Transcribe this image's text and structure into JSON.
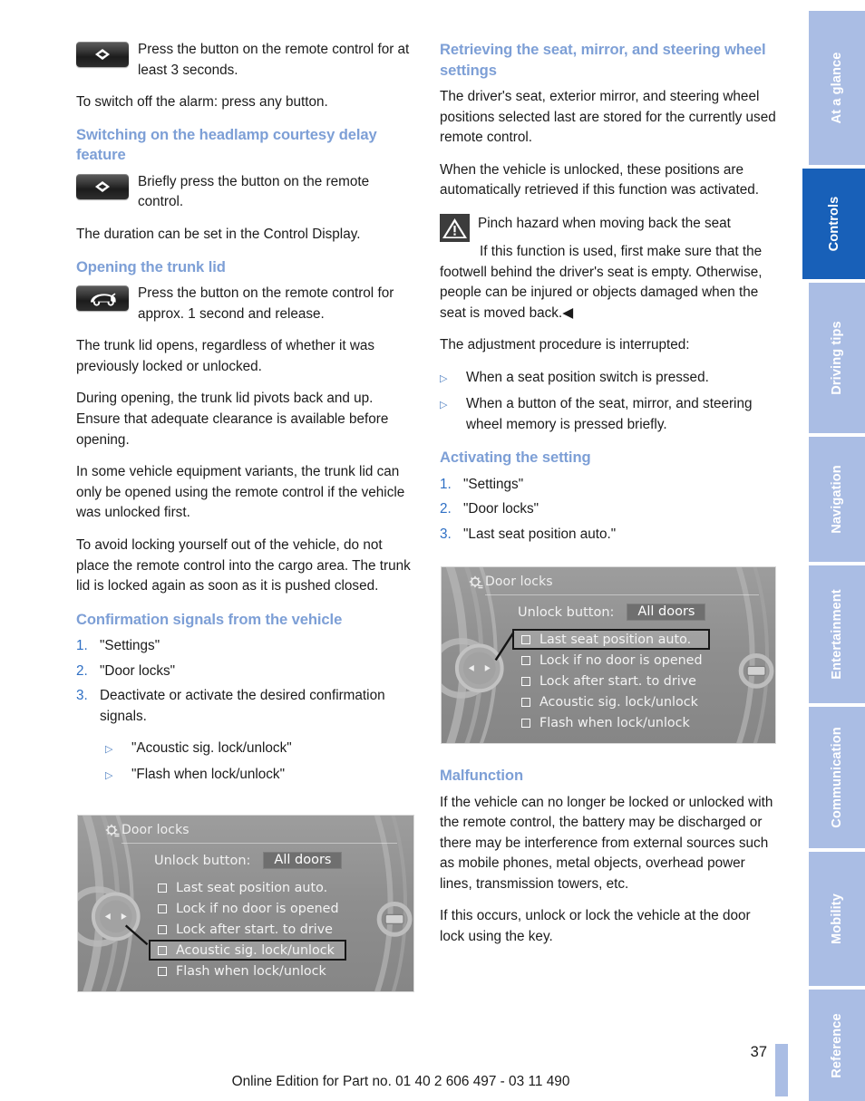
{
  "document": {
    "page_number": "37",
    "footer": "Online Edition for Part no. 01 40 2 606 497 - 03 11 490"
  },
  "colors": {
    "heading_blue": "#7d9fd6",
    "list_number_blue": "#2e6fc4",
    "tab_inactive": "#aabde4",
    "tab_active": "#1860b8",
    "display_grey": "#8f8f8f"
  },
  "left_column": {
    "alarm_instruction": {
      "icon": "remote-diamond-button-icon",
      "text": "Press the button on the remote control for at least 3 seconds."
    },
    "alarm_off_para": "To switch off the alarm: press any button.",
    "headlamp_heading": "Switching on the headlamp courtesy delay feature",
    "headlamp_instruction": {
      "icon": "remote-diamond-button-icon",
      "text": "Briefly press the button on the remote control."
    },
    "headlamp_duration_para": "The duration can be set in the Control Display.",
    "trunk_heading": "Opening the trunk lid",
    "trunk_instruction": {
      "icon": "remote-trunk-button-icon",
      "text": "Press the button on the remote control for approx. 1 second and release."
    },
    "trunk_paragraphs": [
      "The trunk lid opens, regardless of whether it was previously locked or unlocked.",
      "During opening, the trunk lid pivots back and up. Ensure that adequate clearance is available before opening.",
      "In some vehicle equipment variants, the trunk lid can only be opened using the remote control if the vehicle was unlocked first.",
      "To avoid locking yourself out of the vehicle, do not place the remote control into the cargo area. The trunk lid is locked again as soon as it is pushed closed."
    ],
    "confirmation_heading": "Confirmation signals from the vehicle",
    "confirmation_steps": [
      {
        "n": "1.",
        "text": "\"Settings\""
      },
      {
        "n": "2.",
        "text": "\"Door locks\""
      },
      {
        "n": "3.",
        "text": "Deactivate or activate the desired confirmation signals."
      }
    ],
    "confirmation_substeps": [
      "\"Acoustic sig. lock/unlock\"",
      "\"Flash when lock/unlock\""
    ]
  },
  "right_column": {
    "retrieving_heading": "Retrieving the seat, mirror, and steering wheel settings",
    "retrieving_paragraphs": [
      "The driver's seat, exterior mirror, and steering wheel positions selected last are stored for the currently used remote control.",
      "When the vehicle is unlocked, these positions are automatically retrieved if this function was activated."
    ],
    "warning": {
      "icon": "warning-triangle-icon",
      "title": "Pinch hazard when moving back the seat",
      "body": "If this function is used, first make sure that the footwell behind the driver's seat is empty. Otherwise, people can be injured or objects damaged when the seat is moved back.",
      "end_marker": "◀"
    },
    "interrupt_intro": "The adjustment procedure is interrupted:",
    "interrupt_items": [
      "When a seat position switch is pressed.",
      "When a button of the seat, mirror, and steering wheel memory is pressed briefly."
    ],
    "activating_heading": "Activating the setting",
    "activating_steps": [
      {
        "n": "1.",
        "text": "\"Settings\""
      },
      {
        "n": "2.",
        "text": "\"Door locks\""
      },
      {
        "n": "3.",
        "text": "\"Last seat position auto.\""
      }
    ],
    "malfunction_heading": "Malfunction",
    "malfunction_paragraphs": [
      "If the vehicle can no longer be locked or unlocked with the remote control, the battery may be discharged or there may be interference from external sources such as mobile phones, metal objects, overhead power lines, transmission towers, etc.",
      "If this occurs, unlock or lock the vehicle at the door lock using the key."
    ]
  },
  "idrive_display_left": {
    "title": "Door locks",
    "gear_icon": "gear-icon",
    "unlock_label": "Unlock button:",
    "unlock_value": "All doors",
    "options": [
      {
        "label": "Last seat position auto.",
        "selected": false
      },
      {
        "label": "Lock if no door is opened",
        "selected": false
      },
      {
        "label": "Lock after start. to drive",
        "selected": false
      },
      {
        "label": "Acoustic sig. lock/unlock",
        "selected": true
      },
      {
        "label": "Flash when lock/unlock",
        "selected": false
      }
    ]
  },
  "idrive_display_right": {
    "title": "Door locks",
    "gear_icon": "gear-icon",
    "unlock_label": "Unlock button:",
    "unlock_value": "All doors",
    "options": [
      {
        "label": "Last seat position auto.",
        "selected": true
      },
      {
        "label": "Lock if no door is opened",
        "selected": false
      },
      {
        "label": "Lock after start. to drive",
        "selected": false
      },
      {
        "label": "Acoustic sig. lock/unlock",
        "selected": false
      },
      {
        "label": "Flash when lock/unlock",
        "selected": false
      }
    ]
  },
  "sidebar": {
    "tabs": [
      {
        "label": "At a glance",
        "active": false
      },
      {
        "label": "Controls",
        "active": true
      },
      {
        "label": "Driving tips",
        "active": false
      },
      {
        "label": "Navigation",
        "active": false
      },
      {
        "label": "Entertainment",
        "active": false
      },
      {
        "label": "Communication",
        "active": false
      },
      {
        "label": "Mobility",
        "active": false
      },
      {
        "label": "Reference",
        "active": false
      }
    ]
  }
}
